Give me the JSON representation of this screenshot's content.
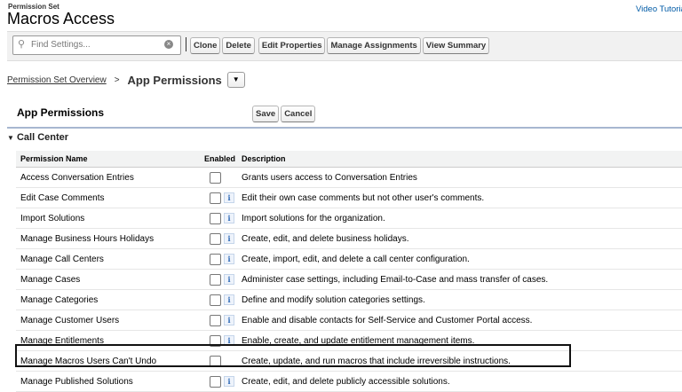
{
  "header": {
    "subtitle": "Permission Set",
    "title": "Macros Access",
    "video_link": "Video Tutorial"
  },
  "toolbar": {
    "search_placeholder": "Find Settings...",
    "buttons": [
      "Clone",
      "Delete",
      "Edit Properties",
      "Manage Assignments",
      "View Summary"
    ]
  },
  "breadcrumb": {
    "link": "Permission Set Overview",
    "sep": ">",
    "current": "App Permissions"
  },
  "section": {
    "title": "App Permissions",
    "save": "Save",
    "cancel": "Cancel",
    "group": "Call Center"
  },
  "table": {
    "headers": [
      "Permission Name",
      "Enabled",
      "Description"
    ],
    "rows": [
      {
        "name": "Access Conversation Entries",
        "info": false,
        "desc": "Grants users access to Conversation Entries"
      },
      {
        "name": "Edit Case Comments",
        "info": true,
        "desc": "Edit their own case comments but not other user's comments."
      },
      {
        "name": "Import Solutions",
        "info": true,
        "desc": "Import solutions for the organization."
      },
      {
        "name": "Manage Business Hours Holidays",
        "info": true,
        "desc": "Create, edit, and delete business holidays."
      },
      {
        "name": "Manage Call Centers",
        "info": true,
        "desc": "Create, import, edit, and delete a call center configuration."
      },
      {
        "name": "Manage Cases",
        "info": true,
        "desc": "Administer case settings, including Email-to-Case and mass transfer of cases."
      },
      {
        "name": "Manage Categories",
        "info": true,
        "desc": "Define and modify solution categories settings."
      },
      {
        "name": "Manage Customer Users",
        "info": true,
        "desc": "Enable and disable contacts for Self-Service and Customer Portal access."
      },
      {
        "name": "Manage Entitlements",
        "info": true,
        "desc": "Enable, create, and update entitlement management items."
      },
      {
        "name": "Manage Macros Users Can't Undo",
        "info": false,
        "desc": "Create, update, and run macros that include irreversible instructions.",
        "highlighted": true
      },
      {
        "name": "Manage Published Solutions",
        "info": true,
        "desc": "Create, edit, and delete publicly accessible solutions."
      }
    ]
  },
  "info_glyph": "i"
}
